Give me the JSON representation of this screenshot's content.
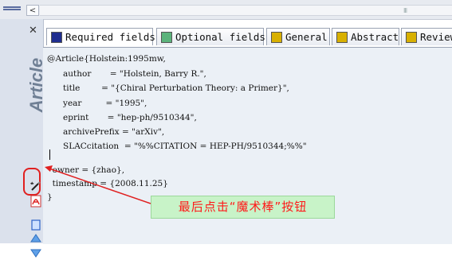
{
  "tabs": [
    {
      "label": "Required fields",
      "color": "#1f2d8f"
    },
    {
      "label": "Optional fields",
      "color": "#5bb37b"
    },
    {
      "label": "General",
      "color": "#d8b000"
    },
    {
      "label": "Abstract",
      "color": "#d8b000"
    },
    {
      "label": "Review",
      "color": "#d8b000"
    }
  ],
  "sidebar": {
    "article_label": "Article",
    "close_icon": "close-icon",
    "icons": [
      "magic-wand-icon",
      "pdf-icon",
      "document-icon",
      "up-arrow-icon",
      "down-arrow-icon"
    ]
  },
  "scrollbar": {
    "grip": "III"
  },
  "editor": {
    "lines": [
      "@Article{Holstein:1995mw,",
      "      author       = \"Holstein, Barry R.\",",
      "      title        = \"{Chiral Perturbation Theory: a Primer}\",",
      "      year         = \"1995\",",
      "      eprint       = \"hep-ph/9510344\",",
      "      archivePrefix = \"arXiv\",",
      "      SLACcitation  = \"%%CITATION = HEP-PH/9510344;%%\"",
      "",
      "  owner = {zhao},",
      "  timestamp = {2008.11.25}",
      "}"
    ]
  },
  "annotation": {
    "text": "最后点击“魔术棒”按钮",
    "color": "#ff1a1a",
    "background": "#c8f3c8"
  }
}
